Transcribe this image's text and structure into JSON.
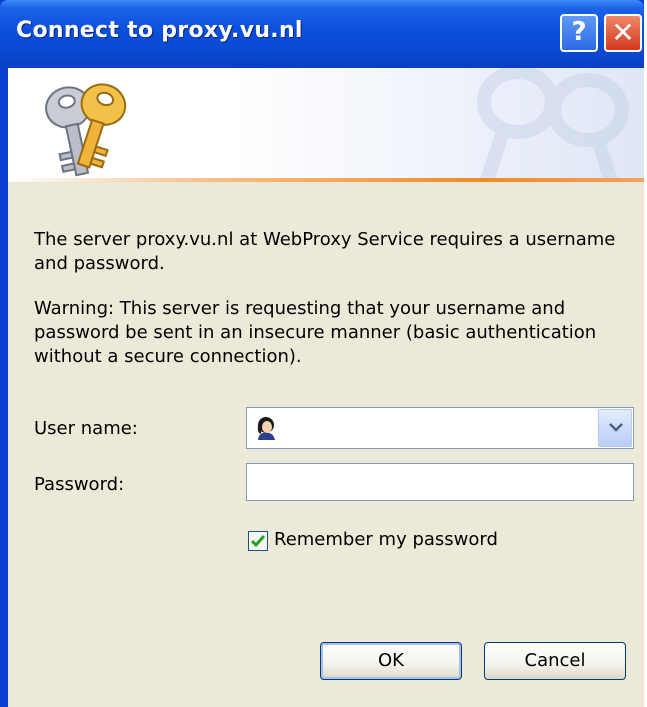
{
  "window": {
    "title": "Connect to proxy.vu.nl",
    "help_label": "?",
    "close_label": "✕"
  },
  "dialog": {
    "message": "The server proxy.vu.nl at WebProxy Service requires a username and password.",
    "warning": "Warning: This server is requesting that your username and password be sent in an insecure manner (basic authentication without a secure connection).",
    "username_label": "User name:",
    "username_value": "",
    "password_label": "Password:",
    "password_value": "",
    "remember_label": "Remember my password",
    "remember_checked": true,
    "ok_label": "OK",
    "cancel_label": "Cancel"
  },
  "icons": {
    "banner": "keys-icon",
    "user": "user-avatar-icon",
    "dropdown": "chevron-down-icon",
    "checkbox": "checkmark-icon"
  },
  "colors": {
    "title_bar": "#0a48d2",
    "dialog_bg": "#ece9d8",
    "accent_line": "#f08a24",
    "check": "#21a121"
  }
}
